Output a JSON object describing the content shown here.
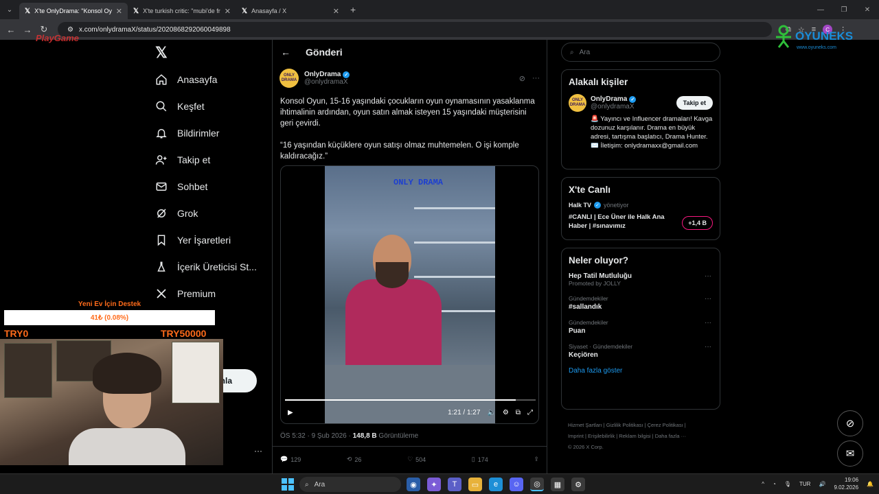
{
  "browser": {
    "tabs": [
      {
        "label": "X'te OnlyDrama: \"Konsol Oyun",
        "active": true
      },
      {
        "label": "X'te turkish critic: \"mubi'de fran",
        "active": false
      },
      {
        "label": "Anasayfa / X",
        "active": false
      }
    ],
    "url": "x.com/onlydramaX/status/2020868292060049898"
  },
  "nav": {
    "items": [
      {
        "label": "Anasayfa",
        "icon": "home-icon"
      },
      {
        "label": "Keşfet",
        "icon": "search-icon"
      },
      {
        "label": "Bildirimler",
        "icon": "bell-icon"
      },
      {
        "label": "Takip et",
        "icon": "add-user-icon"
      },
      {
        "label": "Sohbet",
        "icon": "mail-icon"
      },
      {
        "label": "Grok",
        "icon": "grok-icon"
      },
      {
        "label": "Yer İşaretleri",
        "icon": "bookmark-icon"
      },
      {
        "label": "İçerik Üreticisi St...",
        "icon": "flask-icon"
      },
      {
        "label": "Premium",
        "icon": "x-icon"
      }
    ],
    "partial_button": "nla"
  },
  "main": {
    "header_title": "Gönderi",
    "author_name": "OnlyDrama",
    "author_handle": "@onlydramaX",
    "avatar_text": "ONLY DRAMA",
    "text_p1": "Konsol Oyun, 15-16 yaşındaki çocukların oyun oynamasının yasaklanma ihtimalinin ardından, oyun satın almak isteyen 15 yaşındaki müşterisini geri çevirdi.",
    "text_p2": "“16 yaşından küçüklere oyun satışı olmaz muhtemelen. O işi komple kaldıracağız.”",
    "video_watermark": "ONLY DRAMA",
    "video_time": "1:21 / 1:27",
    "video_progress": 0.92,
    "timestamp": "ÖS 5:32 · 9 Şub 2026 · ",
    "views": "148,8 B",
    "views_label": " Görüntüleme",
    "replies": "129",
    "reposts": "26",
    "likes": "504",
    "bookmarks": "174"
  },
  "right": {
    "search_placeholder": "Ara",
    "related_title": "Alakalı kişiler",
    "related_name": "OnlyDrama",
    "related_handle": "@onlydramaX",
    "follow_label": "Takip et",
    "bio": "🚨 Yayıncı ve Influencer dramaları! Kavga dozunuz karşılanır. Drama en büyük adresi, tartışma başlatıcı, Drama Hunter. ✉️ İletişim: onlydramaxx@gmail.com",
    "live_title": "X'te Canlı",
    "live_host": "Halk TV",
    "live_host_suffix": "yönetiyor",
    "live_topic": "#CANLI | Ece Üner ile Halk Ana Haber | #sınavımız",
    "live_count": "+1,4 B",
    "trends_title": "Neler oluyor?",
    "trends": [
      {
        "category": "",
        "title": "Hep Tatil Mutluluğu",
        "sub": "Promoted by JOLLY"
      },
      {
        "category": "Gündemdekiler",
        "title": "#sallandık",
        "sub": ""
      },
      {
        "category": "Gündemdekiler",
        "title": "Puan",
        "sub": ""
      },
      {
        "category": "Siyaset · Gündemdekiler",
        "title": "Keçiören",
        "sub": ""
      }
    ],
    "show_more": "Daha fazla göster",
    "footer_line1": "Hizmet Şartları  |  Gizlilik Politikası  |  Çerez Politikası  |",
    "footer_line2": "Imprint  |  Erişilebilirlik  |  Reklam bilgisi  |  Daha fazla ···",
    "footer_line3": "© 2026 X Corp."
  },
  "overlay": {
    "brand_logo": "PlayGame",
    "oyuneks_brand": "OYUNEKS",
    "oyuneks_url": "www.oyuneks.com",
    "donate_title": "Yeni Ev İçin Destek",
    "donate_amount": "41₺ (0.08%)",
    "donate_progress": 0.0008,
    "donate_min": "TRY0",
    "donate_max": "TRY50000"
  },
  "taskbar": {
    "search": "Ara",
    "lang": "TUR",
    "time": "19:06",
    "date": "9.02.2026"
  }
}
